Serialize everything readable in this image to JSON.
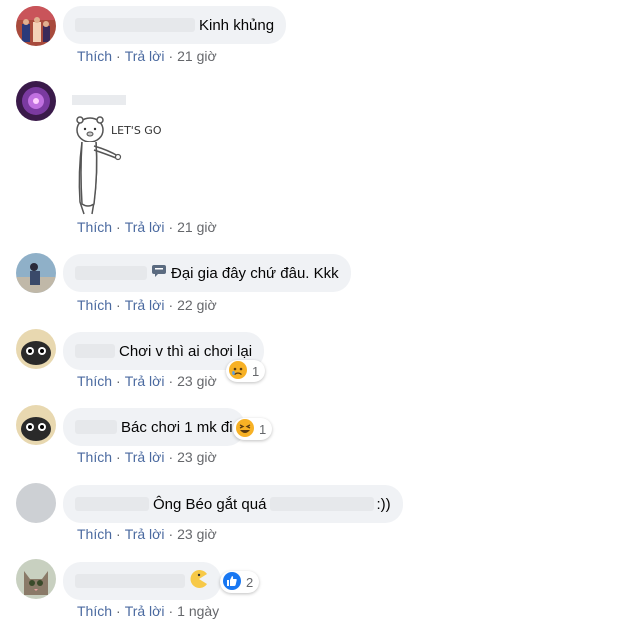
{
  "actions": {
    "like": "Thích",
    "reply": "Trả lời",
    "sep": "·"
  },
  "colors": {
    "bubble": "#f0f2f5",
    "link": "#4b6aa0",
    "meta": "#65676b"
  },
  "comments": [
    {
      "text": "Kinh khủng",
      "time": "21 giờ",
      "avatar": "avatar-photo"
    },
    {
      "sticker_text": "LET'S GO",
      "time": "21 giờ",
      "avatar": "avatar-purple"
    },
    {
      "text": "Đại gia đây chứ đâu. Kkk",
      "time": "22 giờ",
      "avatar": "avatar-people",
      "icon": "chat-bubble-icon"
    },
    {
      "text": "Chơi v thì ai chơi lại",
      "time": "23 giờ",
      "avatar": "avatar-cartoon",
      "reaction": {
        "icon": "sad-reaction-icon",
        "count": "1"
      }
    },
    {
      "text": "Bác chơi 1 mk đi",
      "time": "23 giờ",
      "avatar": "avatar-cartoon",
      "reaction": {
        "icon": "haha-reaction-icon",
        "count": "1"
      }
    },
    {
      "text": "Ông Béo gắt quá",
      "text_end": ":))",
      "time": "23 giờ",
      "avatar": "avatar-default"
    },
    {
      "time": "1 ngày",
      "avatar": "avatar-cat",
      "icon": "pacman-emoji-icon",
      "reaction": {
        "icon": "like-reaction-icon",
        "count": "2"
      }
    }
  ]
}
